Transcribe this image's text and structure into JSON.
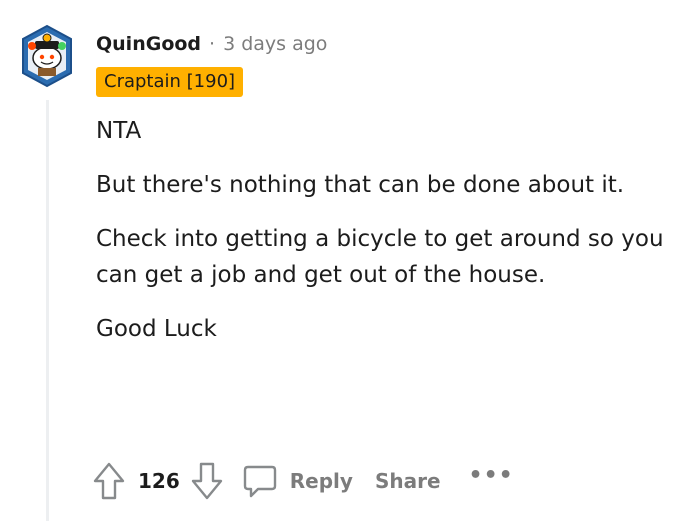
{
  "comment": {
    "author": "QuinGood",
    "separator": "·",
    "timestamp": "3 days ago",
    "flair": "Craptain [190]",
    "body": [
      "NTA",
      "But there's nothing that can be done about it.",
      "Check into getting a bicycle to get around so you can get a job and get out of the house.",
      "Good Luck"
    ],
    "score": "126",
    "actions": {
      "reply_label": "Reply",
      "share_label": "Share",
      "more_label": "•••"
    }
  },
  "colors": {
    "flair_bg": "#ffb000",
    "meta_text": "#7c7c7c",
    "thread_line": "#edeff1",
    "avatar_bg": "#2b6cb0"
  },
  "icons": {
    "avatar": "snoo-avatar-icon",
    "upvote": "upvote-arrow-icon",
    "downvote": "downvote-arrow-icon",
    "reply": "comment-bubble-icon",
    "more": "more-dots-icon"
  }
}
